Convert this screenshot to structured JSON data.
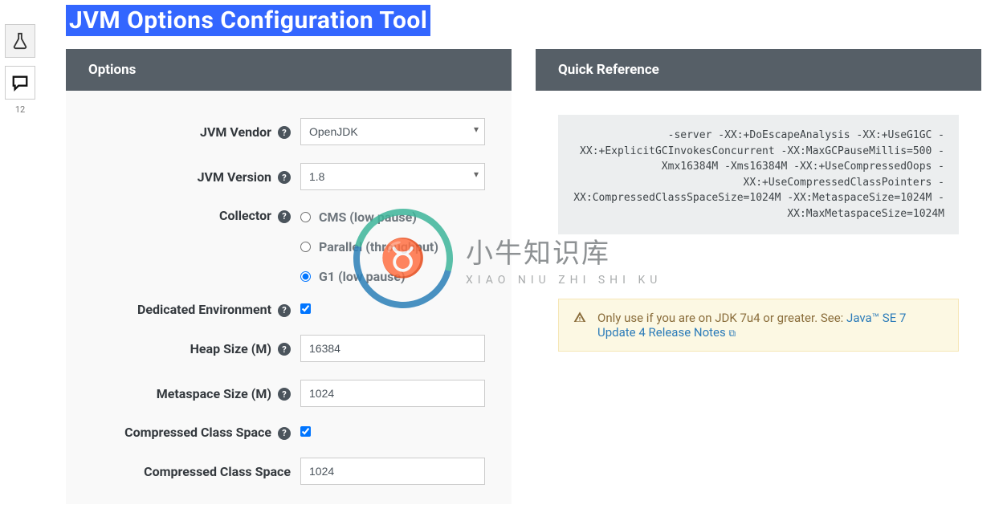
{
  "sidebar": {
    "comment_count": "12"
  },
  "title": "JVM Options Configuration Tool",
  "panels": {
    "options": {
      "title": "Options"
    },
    "reference": {
      "title": "Quick Reference"
    }
  },
  "form": {
    "vendor": {
      "label": "JVM Vendor",
      "value": "OpenJDK"
    },
    "version": {
      "label": "JVM Version",
      "value": "1.8"
    },
    "collector": {
      "label": "Collector",
      "options": {
        "cms": "CMS (low pause)",
        "parallel": "Parallel (throughput)",
        "g1": "G1 (low pause)"
      }
    },
    "dedicated": {
      "label": "Dedicated Environment"
    },
    "heap": {
      "label": "Heap Size (M)",
      "value": "16384"
    },
    "metaspace": {
      "label": "Metaspace Size (M)",
      "value": "1024"
    },
    "ccs_enable": {
      "label": "Compressed Class Space"
    },
    "ccs_size": {
      "label": "Compressed Class Space",
      "value": "1024"
    }
  },
  "reference_output": "-server -XX:+DoEscapeAnalysis -XX:+UseG1GC -XX:+ExplicitGCInvokesConcurrent -XX:MaxGCPauseMillis=500 -Xmx16384M -Xms16384M -XX:+UseCompressedOops -XX:+UseCompressedClassPointers -XX:CompressedClassSpaceSize=1024M -XX:MetaspaceSize=1024M -XX:MaxMetaspaceSize=1024M",
  "alert": {
    "text": "Only use if you are on JDK 7u4 or greater. See: ",
    "link": "Java™ SE 7 Update 4 Release Notes"
  },
  "watermark": {
    "main": "小牛知识库",
    "sub": "XIAO NIU ZHI SHI KU"
  }
}
